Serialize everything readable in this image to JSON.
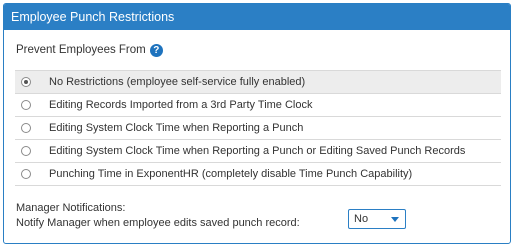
{
  "panel": {
    "title": "Employee Punch Restrictions"
  },
  "restrictions": {
    "heading": "Prevent Employees From",
    "help_icon": "?",
    "options": [
      {
        "label": "No Restrictions (employee self-service fully enabled)",
        "selected": true
      },
      {
        "label": "Editing Records Imported from a 3rd Party Time Clock",
        "selected": false
      },
      {
        "label": "Editing System Clock Time when Reporting a Punch",
        "selected": false
      },
      {
        "label": "Editing System Clock Time when Reporting a Punch or Editing Saved Punch Records",
        "selected": false
      },
      {
        "label": "Punching Time in ExponentHR (completely disable Time Punch Capability)",
        "selected": false
      }
    ]
  },
  "manager_notifications": {
    "heading": "Manager Notifications:",
    "notify_label": "Notify Manager when employee edits saved punch record:",
    "notify_value": "No"
  },
  "colors": {
    "header_bg": "#2b7fc5",
    "selected_row_bg": "#ededed",
    "accent": "#1e73be"
  }
}
